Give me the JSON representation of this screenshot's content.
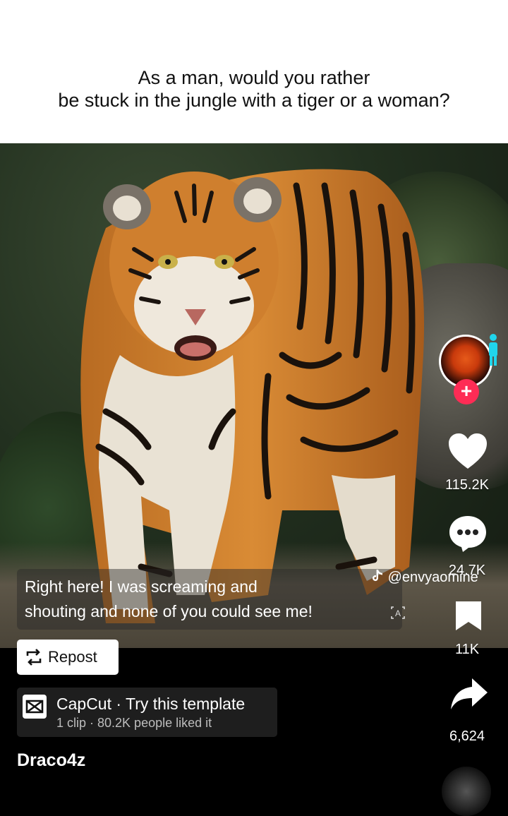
{
  "question": {
    "line1": "As a man, would you rather",
    "line2": "be stuck in the jungle with a tiger or a woman?"
  },
  "rail": {
    "like_count": "115.2K",
    "comment_count": "24.7K",
    "save_count": "11K",
    "share_count": "6,624"
  },
  "sound": {
    "credit": "@envyaomine"
  },
  "caption": {
    "line1": "Right here! I was screaming and",
    "line2": "shouting and none of you could see me!"
  },
  "repost": {
    "label": "Repost"
  },
  "capcut": {
    "title": "CapCut · Try this template",
    "subtitle": "1 clip · 80.2K people liked it"
  },
  "author": {
    "username": "Draco4z"
  },
  "colors": {
    "follow": "#fe2c55",
    "person_badge": "#20d5ec"
  },
  "icons": [
    "heart-icon",
    "comment-icon",
    "bookmark-icon",
    "share-icon",
    "repost-icon",
    "capcut-logo-icon",
    "tiktok-note-icon",
    "person-icon",
    "auto-caption-icon"
  ]
}
